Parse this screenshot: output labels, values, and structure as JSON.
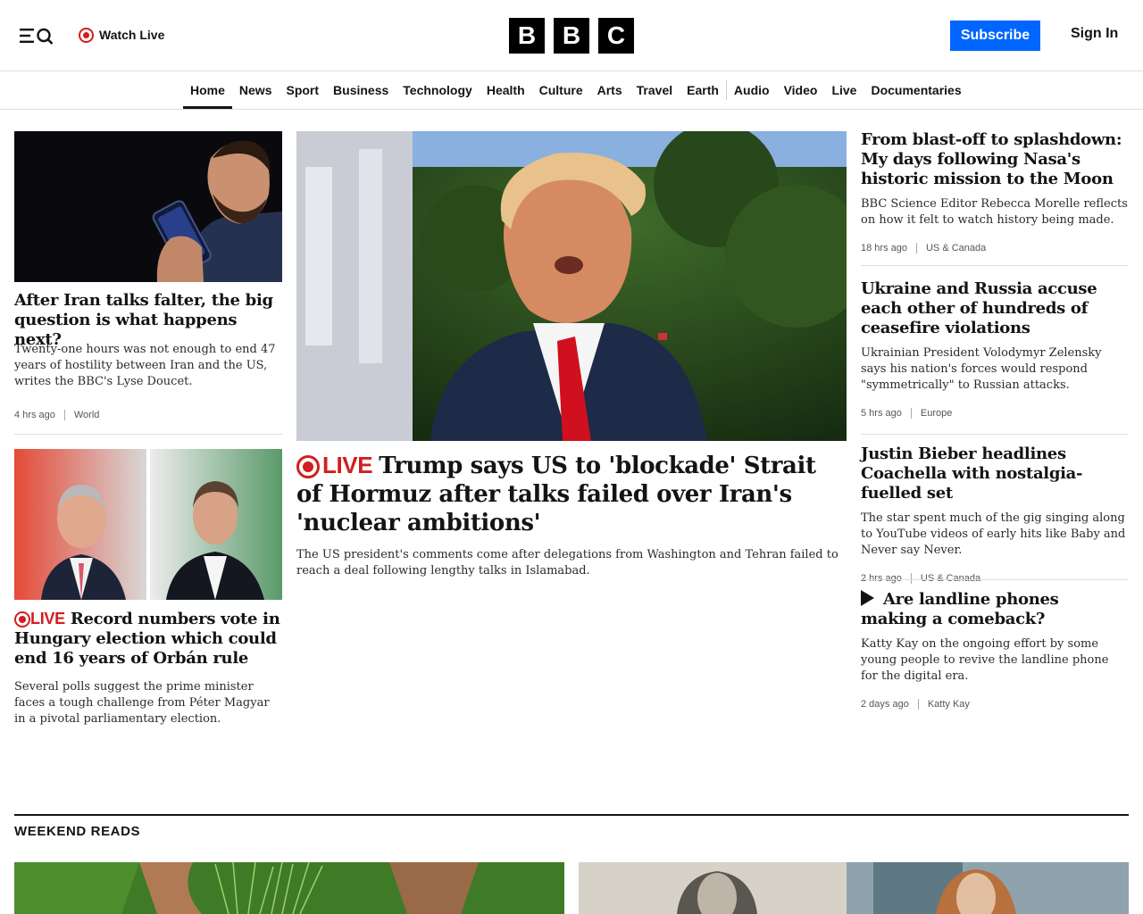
{
  "header": {
    "watch_live": "Watch Live",
    "logo_letters": [
      "B",
      "B",
      "C"
    ],
    "subscribe": "Subscribe",
    "sign_in": "Sign In"
  },
  "nav": {
    "items": [
      "Home",
      "News",
      "Sport",
      "Business",
      "Technology",
      "Health",
      "Culture",
      "Arts",
      "Travel",
      "Earth",
      "Audio",
      "Video",
      "Live",
      "Documentaries"
    ],
    "active": "Home"
  },
  "left": {
    "story1": {
      "headline": "After Iran talks falter, the big question is what happens next?",
      "summary": "Twenty-one hours was not enough to end 47 years of hostility between Iran and the US, writes the BBC's Lyse Doucet.",
      "time": "4 hrs ago",
      "tag": "World"
    },
    "story2": {
      "live": "LIVE",
      "headline": "Record numbers vote in Hungary election which could end 16 years of Orbán rule",
      "summary": "Several polls suggest the prime minister faces a tough challenge from Péter Magyar in a pivotal parliamentary election."
    }
  },
  "center": {
    "live": "LIVE",
    "headline": "Trump says US to 'blockade' Strait of Hormuz after talks failed over Iran's 'nuclear ambitions'",
    "summary": "The US president's comments come after delegations from Washington and Tehran failed to reach a deal following lengthy talks in Islamabad."
  },
  "right": [
    {
      "headline": "From blast-off to splashdown: My days following Nasa's historic mission to the Moon",
      "summary": "BBC Science Editor Rebecca Morelle reflects on how it felt to watch history being made.",
      "time": "18 hrs ago",
      "tag": "US & Canada"
    },
    {
      "headline": "Ukraine and Russia accuse each other of hundreds of ceasefire violations",
      "summary": "Ukrainian President Volodymyr Zelensky says his nation's forces would respond \"symmetrically\" to Russian attacks.",
      "time": "5 hrs ago",
      "tag": "Europe"
    },
    {
      "headline": "Justin Bieber headlines Coachella with nostalgia-fuelled set",
      "summary": "The star spent much of the gig singing along to YouTube videos of early hits like Baby and Never say Never.",
      "time": "2 hrs ago",
      "tag": "US & Canada"
    },
    {
      "headline": "Are landline phones making a comeback?",
      "summary": "Katty Kay on the ongoing effort by some young people to revive the landline phone for the digital era.",
      "time": "2 days ago",
      "tag": "Katty Kay"
    }
  ],
  "weekend_reads": {
    "title": "WEEKEND READS"
  },
  "colors": {
    "live_red": "#d21e1e",
    "subscribe_blue": "#0066ff"
  }
}
